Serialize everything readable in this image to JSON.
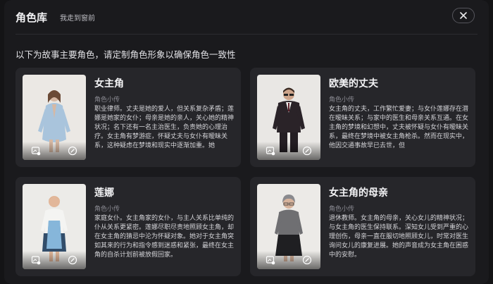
{
  "header": {
    "title": "角色库",
    "subtitle": "我走到窗前",
    "close_icon": "close-icon"
  },
  "instruction": "以下为故事主要角色，请定制角色形象以确保角色一致性",
  "bio_label": "角色小传",
  "characters": [
    {
      "name": "女主角",
      "bio": "职业律师。丈夫是她的爱人，但关系复杂矛盾；莲娜是她家的女仆；母亲是她的亲人，关心她的精神状况；名下还有一名主治医生，负责她的心理治疗。女主角有梦游症，怀疑丈夫与女仆有暧昧关系，这种疑虑在梦境和现实中逐渐加重。她"
    },
    {
      "name": "欧美的丈夫",
      "bio": "女主角的丈夫，工作繁忙爱妻；与女仆莲娜存在潜在暧昧关系；与家中的医生和母亲关系互通。在女主角的梦境和幻想中，丈夫被怀疑与女仆有暧昧关系，最终在梦境中被女主角枪杀。然而在现实中，他因交通事故早已去世，但"
    },
    {
      "name": "莲娜",
      "bio": "家庭女仆。女主角家的女仆，与主人关系比单纯的仆从关系更紧密。莲娜尽职尽责地照顾女主角，却在女主角的猜忌中沦为怀疑对象。她对于女主角突如其来的行为和指令感到迷惑和紧张，最终在女主角的自杀计划前被放假回家。"
    },
    {
      "name": "女主角的母亲",
      "bio": "退休教师。女主角的母亲，关心女儿的精神状况；与女主角的医生保持联系。深知女儿受到严重的心理创伤，母亲一直在服切地照顾女儿，时常对医生询问女儿的康复进展。她的声音成为女主角在困惑中的安慰。"
    }
  ],
  "icons": {
    "picture": "image-settings-icon",
    "edit": "edit-icon"
  },
  "colors": {
    "background": "#1a1a1d",
    "card": "#26262a",
    "accent_text": "#f4f4f6"
  }
}
